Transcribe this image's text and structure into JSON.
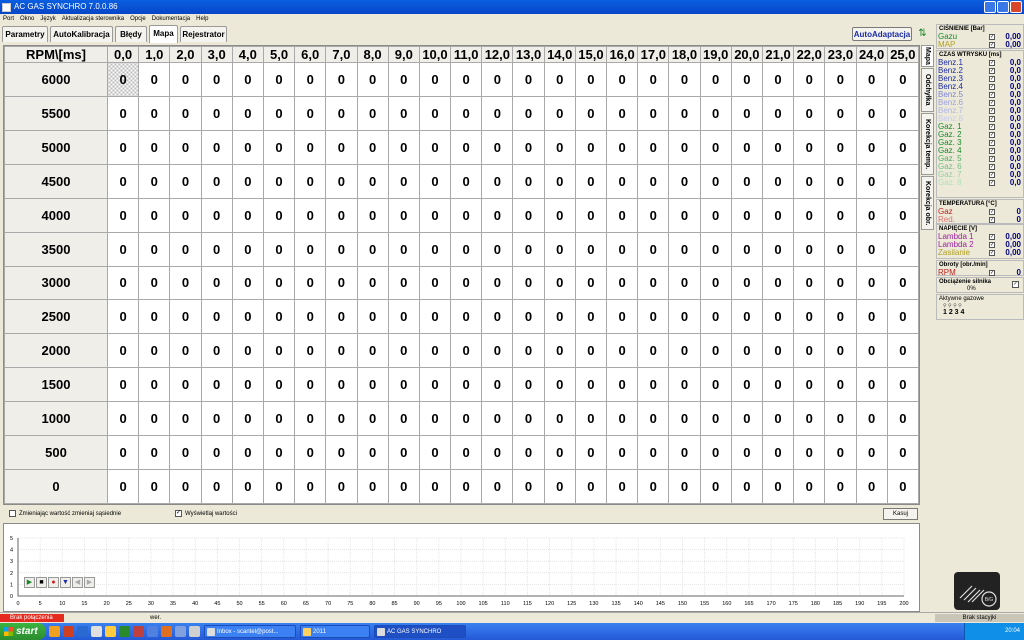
{
  "window": {
    "title": "AC GAS SYNCHRO  7.0.0.86"
  },
  "menu": [
    "Port",
    "Okno",
    "Język",
    "Aktualizacja sterownika",
    "Opcje",
    "Dokumentacja",
    "Help"
  ],
  "tabs": [
    "Parametry",
    "AutoKalibracja",
    "Błędy",
    "Mapa",
    "Rejestrator"
  ],
  "active_tab": "Mapa",
  "autoadapt_label": "AutoAdaptacja",
  "side_tabs": [
    "Mapa",
    "Odchyłka",
    "Korekcja temp.",
    "Korekcja obr."
  ],
  "grid": {
    "corner_label": "RPM\\[ms]",
    "columns": [
      "0,0",
      "1,0",
      "2,0",
      "3,0",
      "4,0",
      "5,0",
      "6,0",
      "7,0",
      "8,0",
      "9,0",
      "10,0",
      "11,0",
      "12,0",
      "13,0",
      "14,0",
      "15,0",
      "16,0",
      "17,0",
      "18,0",
      "19,0",
      "20,0",
      "21,0",
      "22,0",
      "23,0",
      "24,0",
      "25,0"
    ],
    "rows": [
      "6000",
      "5500",
      "5000",
      "4500",
      "4000",
      "3500",
      "3000",
      "2500",
      "2000",
      "1500",
      "1000",
      "500",
      "0"
    ],
    "cell_value": "0"
  },
  "footer": {
    "neighbors_label": "Zmieniając wartość zmieniaj sąsiednie",
    "show_values_label": "Wyświetlaj wartości",
    "clear_label": "Kasuj"
  },
  "chart_data": {
    "type": "line",
    "x_ticks": [
      0,
      5,
      10,
      15,
      20,
      25,
      30,
      35,
      40,
      45,
      50,
      55,
      60,
      65,
      70,
      75,
      80,
      85,
      90,
      95,
      100,
      105,
      110,
      115,
      120,
      125,
      130,
      135,
      140,
      145,
      150,
      155,
      160,
      165,
      170,
      175,
      180,
      185,
      190,
      195,
      200
    ],
    "y_ticks": [
      0,
      1,
      2,
      3,
      4,
      5
    ],
    "xlim": [
      0,
      200
    ],
    "ylim": [
      0,
      5
    ],
    "grid": true,
    "series": []
  },
  "panel": {
    "pressure": {
      "title": "CIŚNIENIE [Bar]",
      "rows": [
        {
          "label": "Gazu",
          "value": "0,00",
          "color": "#1a8a2a"
        },
        {
          "label": "MAP",
          "value": "0,00",
          "color": "#b0a020"
        }
      ]
    },
    "injection": {
      "title": "CZAS WTRYSKU [ms]",
      "rows": [
        {
          "label": "Benz.1",
          "value": "0,0",
          "color": "#1a2ca8"
        },
        {
          "label": "Benz.2",
          "value": "0,0",
          "color": "#1a2ca8"
        },
        {
          "label": "Benz.3",
          "value": "0,0",
          "color": "#1a2ca8"
        },
        {
          "label": "Benz.4",
          "value": "0,0",
          "color": "#1a2ca8"
        },
        {
          "label": "Benz.5",
          "value": "0,0",
          "color": "#7e86d8"
        },
        {
          "label": "Benz.6",
          "value": "0,0",
          "color": "#9aa0e0"
        },
        {
          "label": "Benz.7",
          "value": "0,0",
          "color": "#b0b5e8"
        },
        {
          "label": "Benz.8",
          "value": "0,0",
          "color": "#c8ccf0"
        },
        {
          "label": "Gaz. 1",
          "value": "0,0",
          "color": "#1a8a2a"
        },
        {
          "label": "Gaz. 2",
          "value": "0,0",
          "color": "#1a8a2a"
        },
        {
          "label": "Gaz. 3",
          "value": "0,0",
          "color": "#1a8a2a"
        },
        {
          "label": "Gaz. 4",
          "value": "0,0",
          "color": "#1a8a2a"
        },
        {
          "label": "Gaz. 5",
          "value": "0,0",
          "color": "#50b060"
        },
        {
          "label": "Gaz. 6",
          "value": "0,0",
          "color": "#70c080"
        },
        {
          "label": "Gaz. 7",
          "value": "0,0",
          "color": "#90d0a0"
        },
        {
          "label": "Gaz. 8",
          "value": "0,0",
          "color": "#b0e0bb"
        }
      ]
    },
    "temperature": {
      "title": "TEMPERATURA  [°C]",
      "rows": [
        {
          "label": "Gaz",
          "value": "0",
          "color": "#c02020"
        },
        {
          "label": "Red.",
          "value": "0",
          "color": "#e07070"
        }
      ]
    },
    "voltage": {
      "title": "NAPIĘCIE [V]",
      "rows": [
        {
          "label": "Lambda 1",
          "value": "0,00",
          "color": "#a020a0"
        },
        {
          "label": "Lambda 2",
          "value": "0,00",
          "color": "#a020a0"
        },
        {
          "label": "Zasilanie",
          "value": "0,00",
          "color": "#b0a020"
        }
      ]
    },
    "rpm": {
      "title": "Obroty [obr./min]",
      "rows": [
        {
          "label": "RPM",
          "value": "0",
          "color": "#c02020"
        }
      ]
    },
    "load": {
      "title": "Obciążenie silnika",
      "value": "0%"
    },
    "active_gas": {
      "title": "Aktywne gazowe",
      "cylinders": "1 2 3 4"
    }
  },
  "status": {
    "connection": "Brak połączenia",
    "version_label": "wer.",
    "right": "Brak stacyjki"
  },
  "taskbar": {
    "start": "start",
    "tasks": [
      "Inbox - scantel@post...",
      "2011",
      "AC GAS SYNCHRO"
    ],
    "time": "20:04"
  }
}
